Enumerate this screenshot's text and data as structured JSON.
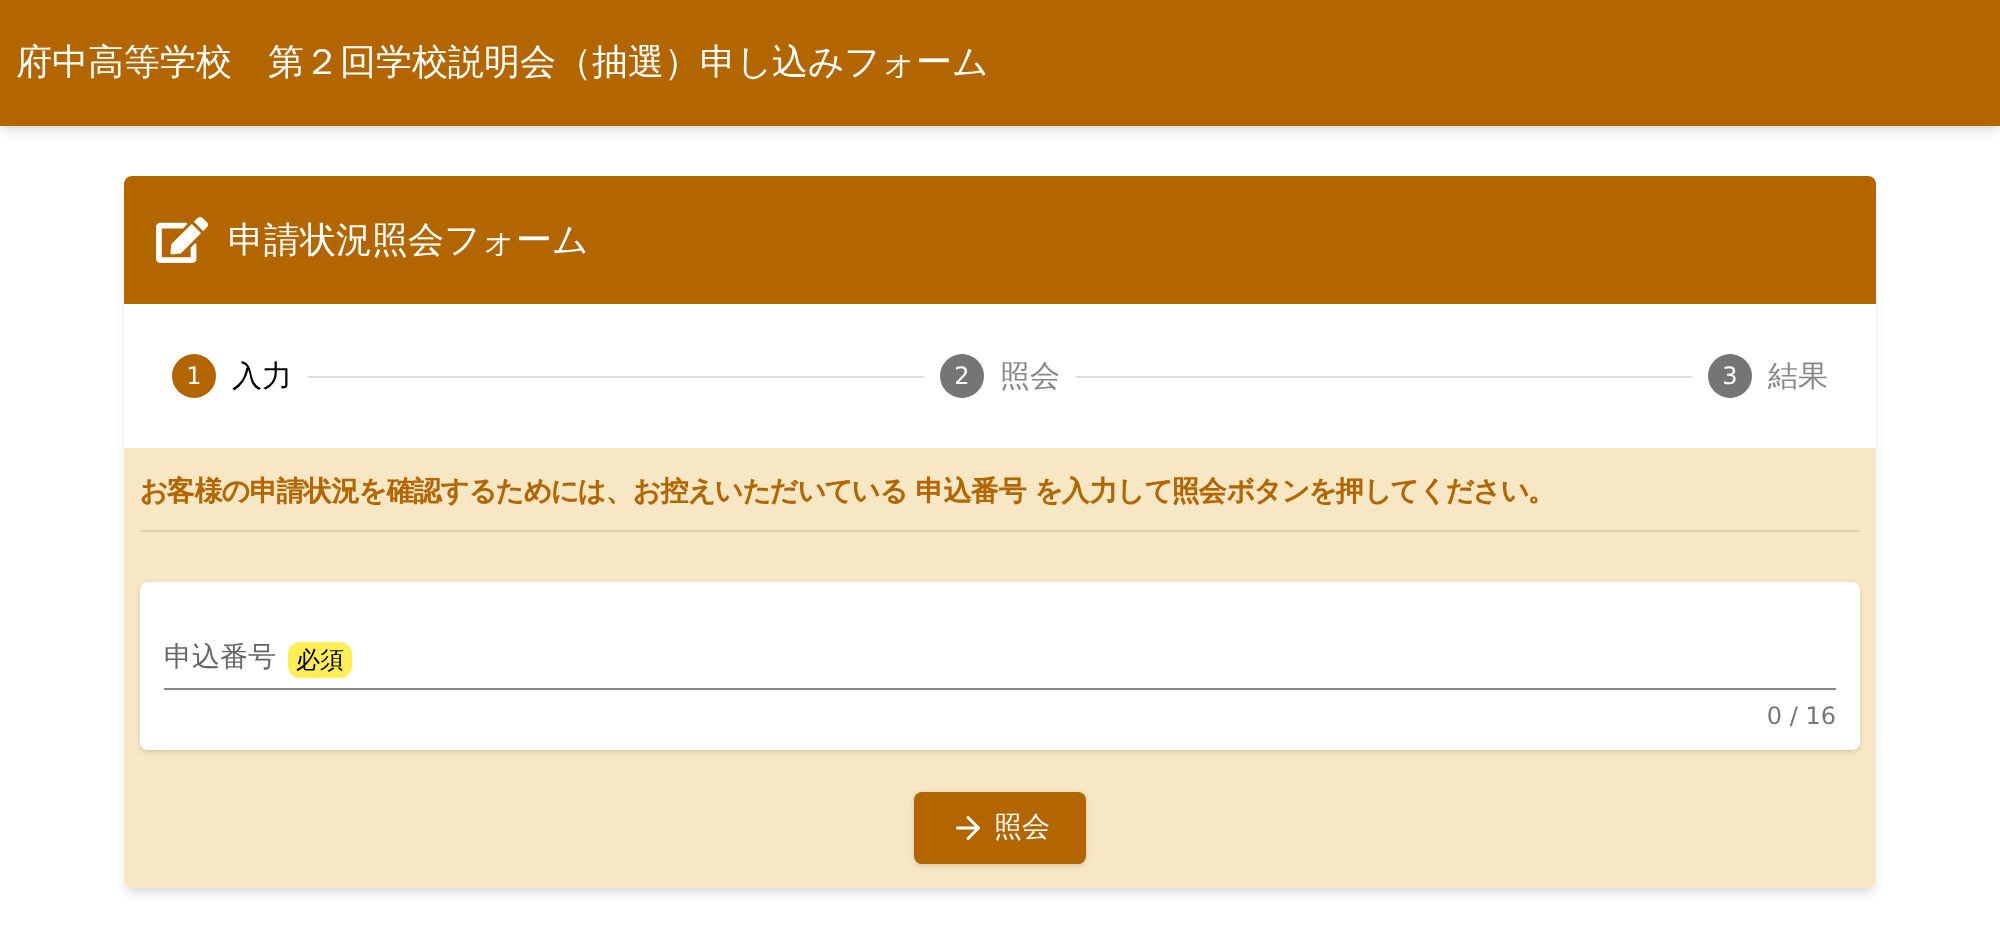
{
  "header": {
    "title": "府中高等学校　第２回学校説明会（抽選）申し込みフォーム"
  },
  "card": {
    "title": "申請状況照会フォーム"
  },
  "steps": [
    {
      "number": "1",
      "label": "入力",
      "selected": true
    },
    {
      "number": "2",
      "label": "照会",
      "selected": false
    },
    {
      "number": "3",
      "label": "結果",
      "selected": false
    }
  ],
  "instruction": "お客様の申請状況を確認するためには、お控えいただいている 申込番号 を入力して照会ボタンを押してください。",
  "field": {
    "label": "申込番号",
    "badge": "必須",
    "counter": "0 / 16"
  },
  "button": {
    "label": "照会"
  }
}
